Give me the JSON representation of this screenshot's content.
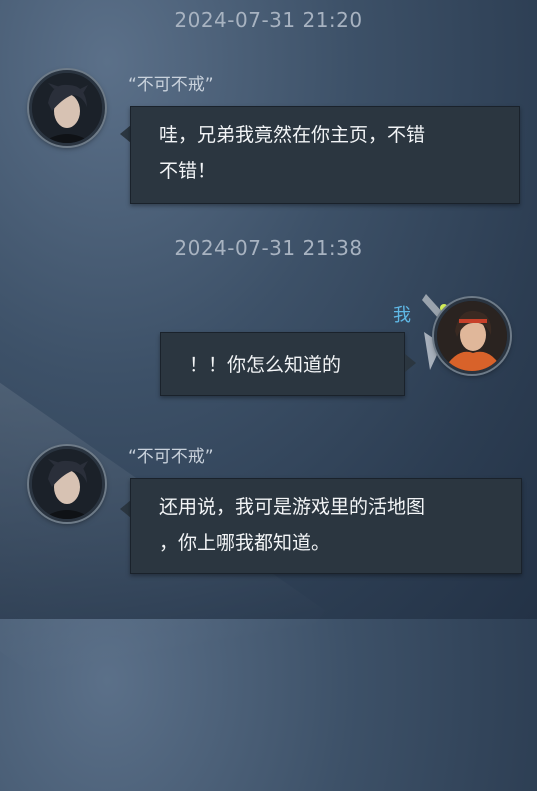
{
  "messages": [
    {
      "timestamp": "2024-07-31 21:20",
      "sender": "“不可不戒”",
      "lines": [
        "哇，兄弟我竟然在你主页，不错",
        "不错！"
      ]
    },
    {
      "timestamp": "2024-07-31 21:38",
      "sender": "我",
      "lines": [
        "！！你怎么知道的"
      ]
    },
    {
      "sender": "“不可不戒”",
      "lines": [
        "还用说，我可是游戏里的活地图",
        "，你上哪我都知道。"
      ]
    }
  ],
  "icons": {
    "sender_avatar": "dark-haired-man-avatar",
    "my_avatar": "orange-armored-warrior-avatar",
    "frame_decoration": "sword-frame-ornament-icon"
  },
  "colors": {
    "background": "#34475d",
    "bubble": "#2b3640",
    "name_accent": "#5fb8e6",
    "timestamp": "#a8b3c1"
  }
}
